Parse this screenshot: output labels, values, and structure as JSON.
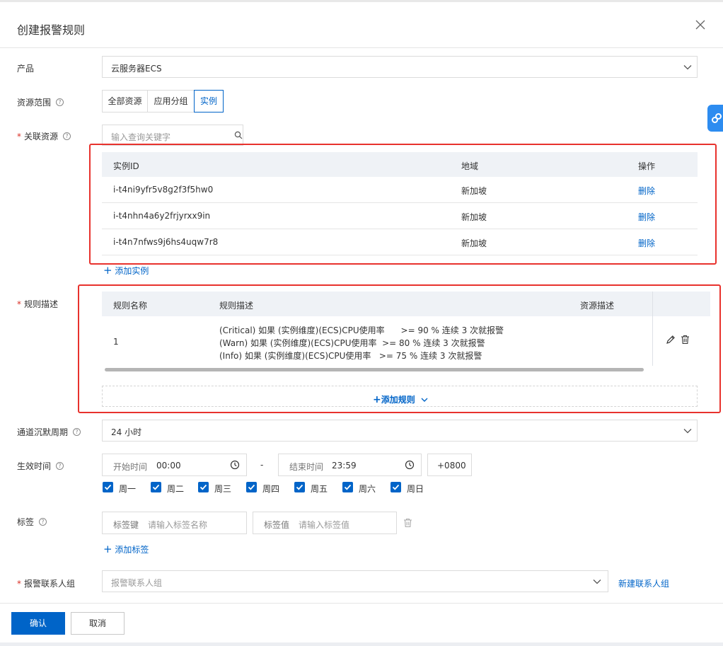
{
  "dialog": {
    "title": "创建报警规则"
  },
  "product": {
    "label": "产品",
    "value": "云服务器ECS"
  },
  "scope": {
    "label": "资源范围",
    "options": [
      "全部资源",
      "应用分组",
      "实例"
    ],
    "selected": "实例"
  },
  "related": {
    "label": "关联资源",
    "search_placeholder": "输入查询关键字",
    "columns": [
      "实例ID",
      "地域",
      "操作"
    ],
    "rows": [
      {
        "id": "i-t4ni9yfr5v8g2f3f5hw0",
        "region": "新加坡",
        "action": "删除"
      },
      {
        "id": "i-t4nhn4a6y2frjyrxx9in",
        "region": "新加坡",
        "action": "删除"
      },
      {
        "id": "i-t4n7nfws9j6hs4uqw7r8",
        "region": "新加坡",
        "action": "删除"
      }
    ],
    "add_label": "添加实例"
  },
  "rules": {
    "label": "规则描述",
    "columns": [
      "规则名称",
      "规则描述",
      "资源描述"
    ],
    "row": {
      "name": "1",
      "lines": [
        "(Critical) 如果 (实例维度)(ECS)CPU使用率      >= 90 % 连续 3 次就报警",
        "(Warn) 如果 (实例维度)(ECS)CPU使用率  >= 80 % 连续 3 次就报警",
        "(Info) 如果 (实例维度)(ECS)CPU使用率   >= 75 % 连续 3 次就报警"
      ]
    },
    "add_label": "添加规则"
  },
  "silence": {
    "label": "通道沉默周期",
    "value": "24 小时"
  },
  "effective": {
    "label": "生效时间",
    "start_prefix": "开始时间",
    "start_value": "00:00",
    "dash": "-",
    "end_prefix": "结束时间",
    "end_value": "23:59",
    "timezone": "+0800",
    "days": [
      "周一",
      "周二",
      "周三",
      "周四",
      "周五",
      "周六",
      "周日"
    ]
  },
  "tags": {
    "label": "标签",
    "key_prefix": "标签键",
    "key_placeholder": "请输入标签名称",
    "value_prefix": "标签值",
    "value_placeholder": "请输入标签值",
    "add_label": "添加标签"
  },
  "contacts": {
    "label": "报警联系人组",
    "placeholder": "报警联系人组",
    "new_link": "新建联系人组"
  },
  "footer": {
    "confirm": "确认",
    "cancel": "取消"
  },
  "colors": {
    "primary": "#0064c8",
    "highlight": "#e8322d",
    "required": "#d93026"
  }
}
